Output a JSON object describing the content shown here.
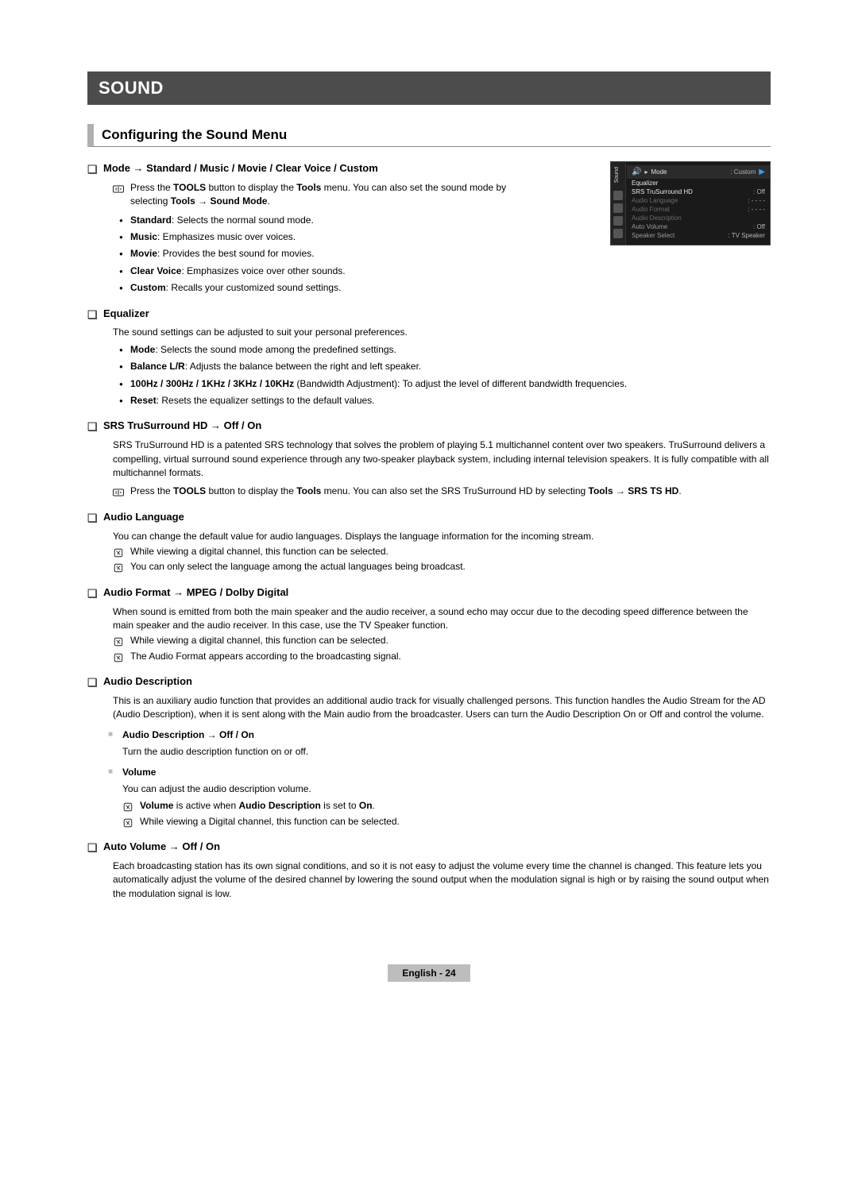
{
  "title": "SOUND",
  "section": "Configuring the Sound Menu",
  "mode": {
    "heading": "Mode → Standard / Music / Movie / Clear Voice / Custom",
    "tools_pre": "Press the ",
    "tools_bold1": "TOOLS",
    "tools_mid": " button to display the ",
    "tools_bold2": "Tools",
    "tools_after": " menu. You can also set the sound mode by selecting ",
    "tools_bold3": "Tools → Sound Mode",
    "tools_end": ".",
    "items": [
      {
        "b": "Standard",
        "t": ": Selects the normal sound mode."
      },
      {
        "b": "Music",
        "t": ": Emphasizes music over voices."
      },
      {
        "b": "Movie",
        "t": ": Provides the best sound for movies."
      },
      {
        "b": "Clear Voice",
        "t": ": Emphasizes voice over other sounds."
      },
      {
        "b": "Custom",
        "t": ": Recalls your customized sound settings."
      }
    ]
  },
  "equalizer": {
    "heading": "Equalizer",
    "intro": "The sound settings can be adjusted to suit your personal preferences.",
    "items": [
      {
        "b": "Mode",
        "t": ": Selects the sound mode among the predefined settings."
      },
      {
        "b": "Balance L/R",
        "t": ": Adjusts the balance between the right and left speaker."
      },
      {
        "b": "100Hz / 300Hz / 1KHz / 3KHz / 10KHz",
        "t": " (Bandwidth Adjustment): To adjust the level of different bandwidth frequencies."
      },
      {
        "b": "Reset",
        "t": ": Resets the equalizer settings to the default values."
      }
    ]
  },
  "srs": {
    "heading": "SRS TruSurround HD → Off / On",
    "para": "SRS TruSurround HD is a patented SRS technology that solves the problem of playing 5.1 multichannel content over two speakers. TruSurround delivers a compelling, virtual surround sound experience through any two-speaker playback system, including internal television speakers. It is fully compatible with all multichannel formats.",
    "tools_pre": "Press the ",
    "tools_bold1": "TOOLS",
    "tools_mid": " button to display the ",
    "tools_bold2": "Tools",
    "tools_after": " menu. You can also set the SRS TruSurround HD by selecting ",
    "tools_bold3": "Tools → SRS TS HD",
    "tools_end": "."
  },
  "audio_language": {
    "heading": "Audio Language",
    "para": "You can change the default value for audio languages. Displays the language information for the incoming stream.",
    "notes": [
      "While viewing a digital channel, this function can be selected.",
      "You can only select the language among the actual languages being broadcast."
    ]
  },
  "audio_format": {
    "heading": "Audio Format → MPEG / Dolby Digital",
    "para": "When sound is emitted from both the main speaker and the audio receiver, a sound echo may occur due to the decoding speed difference between the main speaker and the audio receiver. In this case, use the TV Speaker function.",
    "notes": [
      "While viewing a digital channel, this function can be selected.",
      "The Audio Format appears according to the broadcasting signal."
    ]
  },
  "audio_description": {
    "heading": "Audio Description",
    "para": "This is an auxiliary audio function that provides an additional audio track for visually challenged persons. This function handles the Audio Stream for the AD (Audio Description), when it is sent along with the Main audio from the broadcaster. Users can turn the Audio Description On or Off and control the volume.",
    "sub1_heading": "Audio Description → Off / On",
    "sub1_desc": "Turn the audio description function on or off.",
    "sub2_heading": "Volume",
    "sub2_desc": "You can adjust the audio description volume.",
    "sub2_note1_pre": "",
    "sub2_note1_b1": "Volume",
    "sub2_note1_mid": " is active when ",
    "sub2_note1_b2": "Audio Description",
    "sub2_note1_after": " is set to ",
    "sub2_note1_b3": "On",
    "sub2_note1_end": ".",
    "sub2_note2": "While viewing a Digital channel, this function can be selected."
  },
  "auto_volume": {
    "heading": "Auto Volume → Off / On",
    "para": "Each broadcasting station has its own signal conditions, and so it is not easy to adjust the volume every time the channel is changed. This feature lets you automatically adjust the volume of the desired channel by lowering the sound output when the modulation signal is high or by raising the sound output when the modulation signal is low."
  },
  "osd": {
    "vlabel": "Sound",
    "mode_label": "Mode",
    "mode_value": ": Custom",
    "rows": [
      {
        "label": "Equalizer",
        "value": "",
        "cls": "hl"
      },
      {
        "label": "SRS TruSurround HD",
        "value": ": Off",
        "cls": "hl"
      },
      {
        "label": "Audio Language",
        "value": ": - - - -",
        "cls": "dim"
      },
      {
        "label": "Audio Format",
        "value": ": - - - -",
        "cls": "dim"
      },
      {
        "label": "Audio Description",
        "value": "",
        "cls": "dim"
      },
      {
        "label": "Auto Volume",
        "value": ": Off",
        "cls": ""
      },
      {
        "label": "Speaker Select",
        "value": ": TV Speaker",
        "cls": ""
      }
    ]
  },
  "footer_lang": "English - ",
  "footer_page": "24"
}
